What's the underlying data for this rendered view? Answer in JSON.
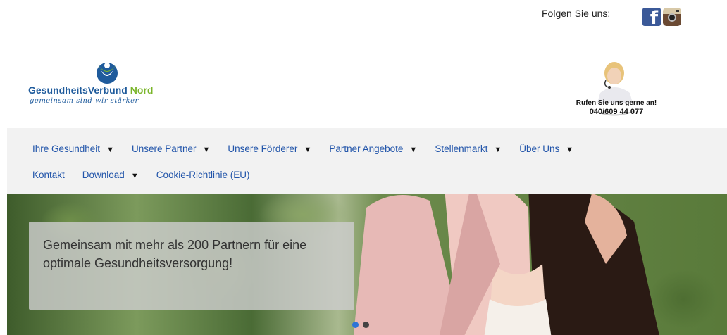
{
  "header": {
    "follow_label": "Folgen Sie uns:",
    "social_icons": [
      "facebook-icon",
      "instagram-icon"
    ]
  },
  "logo": {
    "name_part1": "GesundheitsVerbund",
    "name_part2": "Nord",
    "tagline": "gemeinsam sind wir stärker",
    "colors": {
      "blue": "#1f5b9c",
      "green": "#7ab52a"
    }
  },
  "contact": {
    "call_text": "Rufen Sie uns gerne an!",
    "phone": "040/609 44 077"
  },
  "nav": {
    "row1": [
      {
        "label": "Ihre Gesundheit",
        "dropdown": true
      },
      {
        "label": "Unsere Partner",
        "dropdown": true
      },
      {
        "label": "Unsere Förderer",
        "dropdown": true
      },
      {
        "label": "Partner Angebote",
        "dropdown": true
      },
      {
        "label": "Stellenmarkt",
        "dropdown": true
      },
      {
        "label": "Über Uns",
        "dropdown": true
      }
    ],
    "row2": [
      {
        "label": "Kontakt",
        "dropdown": false
      },
      {
        "label": "Download",
        "dropdown": true
      },
      {
        "label": "Cookie-Richtlinie (EU)",
        "dropdown": false
      }
    ],
    "caret": "▼",
    "link_color": "#2255aa"
  },
  "hero": {
    "caption": "Gemeinsam mit mehr als 200 Partnern für eine optimale Gesundheitsversorgung!",
    "slides_total": 2,
    "active_slide": 1,
    "active_color": "#2e74d6"
  }
}
